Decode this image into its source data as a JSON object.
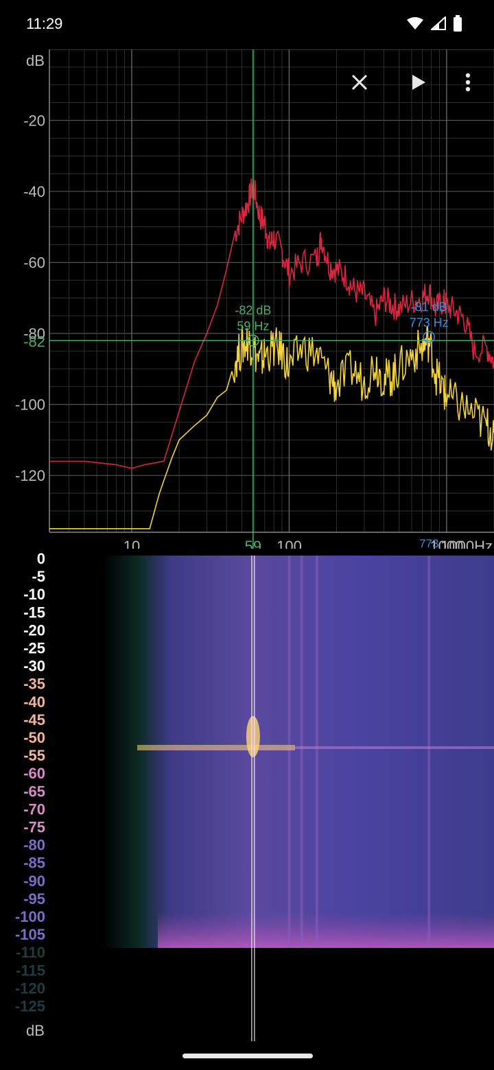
{
  "status_bar": {
    "time": "11:29",
    "icons": [
      "wifi-icon",
      "cell-signal-icon",
      "battery-icon"
    ]
  },
  "toolbar": {
    "actions": [
      "close-icon",
      "play-icon",
      "more-vert-icon"
    ]
  },
  "colors": {
    "background": "#000000",
    "grid": "#3a3a3a",
    "cursor": "#4caf70",
    "peak_marker": "#3f8fd6",
    "red_trace": "#d8283f",
    "yellow_trace": "#f2d33a",
    "spectro_mid": "#6a4fa8",
    "spectro_hot": "#ffd27a"
  },
  "chart_data": [
    {
      "type": "line",
      "title": "",
      "xlabel": "Hz",
      "ylabel": "dB",
      "x_scale": "log",
      "xlim": [
        3,
        2000
      ],
      "ylim": [
        -136,
        0
      ],
      "x_tick_labels": [
        "10",
        "100",
        "1000",
        "1000Hz"
      ],
      "y_tick_labels": [
        "-20",
        "-40",
        "-60",
        "-80",
        "-100",
        "-120"
      ],
      "y_unit_label": "dB",
      "grid": true,
      "series": [
        {
          "color": "#d8283f",
          "x": [
            3,
            5,
            8,
            10,
            12,
            16,
            20,
            25,
            30,
            35,
            40,
            45,
            50,
            55,
            59,
            65,
            70,
            75,
            80,
            90,
            100,
            120,
            150,
            160,
            180,
            200,
            230,
            260,
            300,
            350,
            400,
            450,
            500,
            600,
            700,
            773,
            850,
            950,
            1000,
            1150,
            1300,
            1500,
            1800,
            2000
          ],
          "y": [
            -116,
            -116,
            -117,
            -118,
            -117,
            -116,
            -102,
            -88,
            -80,
            -72,
            -62,
            -52,
            -47,
            -43,
            -38,
            -47,
            -49,
            -55,
            -53,
            -57,
            -63,
            -60,
            -59,
            -53,
            -61,
            -62,
            -64,
            -68,
            -69,
            -75,
            -70,
            -72,
            -73,
            -71,
            -70,
            -68,
            -73,
            -71,
            -72,
            -74,
            -76,
            -85,
            -84,
            -88
          ]
        },
        {
          "color": "#f2d33a",
          "x": [
            3,
            5,
            8,
            10,
            12,
            13,
            15,
            18,
            20,
            25,
            30,
            35,
            40,
            45,
            50,
            55,
            59,
            65,
            70,
            80,
            90,
            100,
            120,
            150,
            180,
            200,
            250,
            300,
            350,
            400,
            450,
            500,
            600,
            700,
            773,
            850,
            950,
            1000,
            1200,
            1500,
            1800,
            2000
          ],
          "y": [
            -135,
            -135,
            -135,
            -135,
            -135,
            -135,
            -125,
            -115,
            -110,
            -106,
            -103,
            -98,
            -96,
            -88,
            -84,
            -82,
            -84,
            -88,
            -86,
            -84,
            -85,
            -90,
            -84,
            -86,
            -92,
            -95,
            -90,
            -94,
            -88,
            -93,
            -92,
            -90,
            -86,
            -84,
            -82,
            -91,
            -96,
            -98,
            -100,
            -103,
            -106,
            -108
          ]
        }
      ],
      "cursor": {
        "freq_label": "59",
        "db_label": "-82",
        "marker_db": "-82 dB",
        "marker_hz": "59 Hz"
      },
      "peak": {
        "freq_label": "773",
        "marker_db": "-81 dB",
        "marker_hz": "773 Hz"
      }
    },
    {
      "type": "heatmap",
      "title": "",
      "x_scale": "log",
      "xlim": [
        3,
        2000
      ],
      "y_tick_labels": [
        "0",
        "-5",
        "-10",
        "-15",
        "-20",
        "-25",
        "-30",
        "-35",
        "-40",
        "-45",
        "-50",
        "-55",
        "-60",
        "-65",
        "-70",
        "-75",
        "-80",
        "-85",
        "-90",
        "-95",
        "-100",
        "-105",
        "-110",
        "-115",
        "-120",
        "-125"
      ],
      "y_unit_label": "dB",
      "bright_lines_hz": [
        59,
        100,
        120,
        150,
        773
      ]
    }
  ]
}
